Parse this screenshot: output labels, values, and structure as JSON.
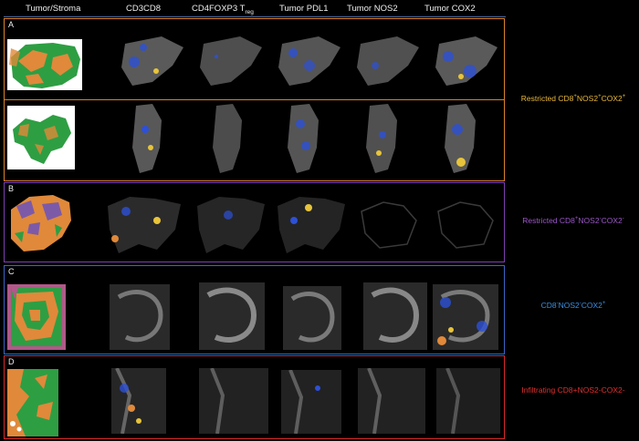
{
  "columns": [
    {
      "key": "tumor_stroma",
      "label": "Tumor/Stroma"
    },
    {
      "key": "cd3cd8",
      "label": "CD3CD8"
    },
    {
      "key": "cd4foxp3",
      "label": "CD4FOXP3 T",
      "sub": "reg"
    },
    {
      "key": "pdl1",
      "label": "Tumor PDL1"
    },
    {
      "key": "nos2",
      "label": "Tumor NOS2"
    },
    {
      "key": "cox2",
      "label": "Tumor COX2"
    }
  ],
  "panels": [
    {
      "id": "A",
      "label": "A",
      "border": "#d9822b"
    },
    {
      "id": "B",
      "label": "B",
      "border": "#7d3fb0"
    },
    {
      "id": "C",
      "label": "C",
      "border": "#3a66c4"
    },
    {
      "id": "D",
      "label": "D",
      "border": "#d62a2a"
    }
  ],
  "side_labels": [
    {
      "id": "A",
      "pre": "Restricted CD8",
      "s1": "+",
      "m1": "NOS2",
      "s2": "+",
      "m2": "COX2",
      "s3": "+",
      "color": "#e8b83a"
    },
    {
      "id": "B",
      "pre": "Restricted CD8",
      "s1": "+",
      "m1": "NOS2",
      "s2": "-",
      "m2": "COX2",
      "s3": "-",
      "color": "#9b57c7"
    },
    {
      "id": "C",
      "pre": "CD8",
      "s1": "-",
      "m1": "NOS2",
      "s2": "-",
      "m2": "COX2",
      "s3": "+",
      "color": "#3d8fe0"
    },
    {
      "id": "D",
      "text": "Infiltrating CD8+NOS2-COX2-",
      "color": "#e03030"
    }
  ],
  "colors": {
    "tumor": "#2e9e43",
    "stroma": "#e0893a",
    "marker_blue": "#2d50d6",
    "marker_yellow": "#e8c43a"
  }
}
